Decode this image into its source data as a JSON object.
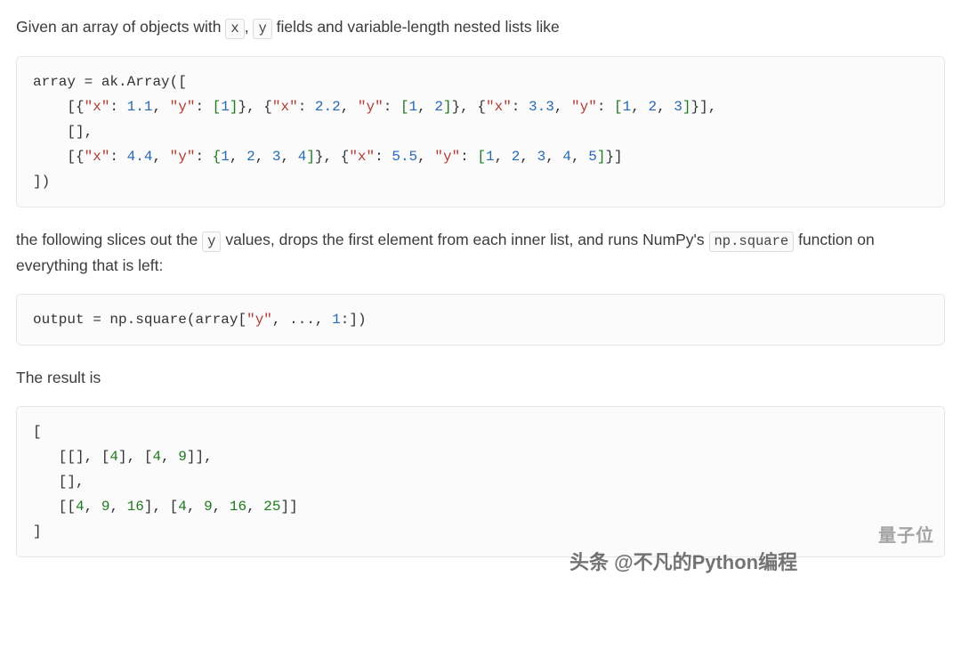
{
  "para1": {
    "pre": "Given an array of objects with ",
    "code1": "x",
    "mid1": ", ",
    "code2": "y",
    "post": " fields and variable-length nested lists like"
  },
  "code1": {
    "l1a": "array ",
    "l1b": "=",
    "l1c": " ak",
    "l1d": ".",
    "l1e": "Array",
    "l1f": "([",
    "l2a": "    [{",
    "l2b": "\"x\"",
    "l2c": ": ",
    "l2d": "1.1",
    "l2e": ", ",
    "l2f": "\"y\"",
    "l2g": ": ",
    "l2h": "[",
    "l2i": "1",
    "l2j": "]",
    "l2k": "}, {",
    "l2l": "\"x\"",
    "l2m": ": ",
    "l2n": "2.2",
    "l2o": ", ",
    "l2p": "\"y\"",
    "l2q": ": ",
    "l2r": "[",
    "l2s": "1",
    "l2t": ", ",
    "l2u": "2",
    "l2v": "]",
    "l2w": "}, {",
    "l2x": "\"x\"",
    "l2y": ": ",
    "l2z": "3.3",
    "l2aa": ", ",
    "l2ab": "\"y\"",
    "l2ac": ": ",
    "l2ad": "[",
    "l2ae": "1",
    "l2af": ", ",
    "l2ag": "2",
    "l2ah": ", ",
    "l2ai": "3",
    "l2aj": "]",
    "l2ak": "}],",
    "l3": "    [],",
    "l4a": "    [{",
    "l4b": "\"x\"",
    "l4c": ": ",
    "l4d": "4.4",
    "l4e": ", ",
    "l4f": "\"y\"",
    "l4g": ": ",
    "l4h": "{",
    "l4i": "1",
    "l4j": ", ",
    "l4k": "2",
    "l4l": ", ",
    "l4m": "3",
    "l4n": ", ",
    "l4o": "4",
    "l4p": "]",
    "l4q": "}, {",
    "l4r": "\"x\"",
    "l4s": ": ",
    "l4t": "5.5",
    "l4u": ", ",
    "l4v": "\"y\"",
    "l4w": ": ",
    "l4x": "[",
    "l4y": "1",
    "l4z": ", ",
    "l4aa": "2",
    "l4ab": ", ",
    "l4ac": "3",
    "l4ad": ", ",
    "l4ae": "4",
    "l4af": ", ",
    "l4ag": "5",
    "l4ah": "]",
    "l4ai": "}]",
    "l5": "])"
  },
  "para2": {
    "pre": "the following slices out the ",
    "code1": "y",
    "mid": " values, drops the first element from each inner list, and runs NumPy's ",
    "code2": "np.square",
    "post": " function on everything that is left:"
  },
  "code2": {
    "a": "output ",
    "b": "=",
    "c": " np",
    "d": ".",
    "e": "square",
    "f": "(",
    "g": "array",
    "h": "[",
    "i": "\"y\"",
    "j": ", ",
    "k": "...",
    "l": ", ",
    "m": "1",
    "n": ":])"
  },
  "para3": "The result is",
  "code3": {
    "l1": "[",
    "l2a": "   [[], [",
    "l2b": "4",
    "l2c": "], [",
    "l2d": "4",
    "l2e": ", ",
    "l2f": "9",
    "l2g": "]],",
    "l3": "   [],",
    "l4a": "   [[",
    "l4b": "4",
    "l4c": ", ",
    "l4d": "9",
    "l4e": ", ",
    "l4f": "16",
    "l4g": "], [",
    "l4h": "4",
    "l4i": ", ",
    "l4j": "9",
    "l4k": ", ",
    "l4l": "16",
    "l4m": ", ",
    "l4n": "25",
    "l4o": "]]",
    "l5": "]"
  },
  "watermark1": "头条 @不凡的Python编程",
  "watermark2": "量子位"
}
